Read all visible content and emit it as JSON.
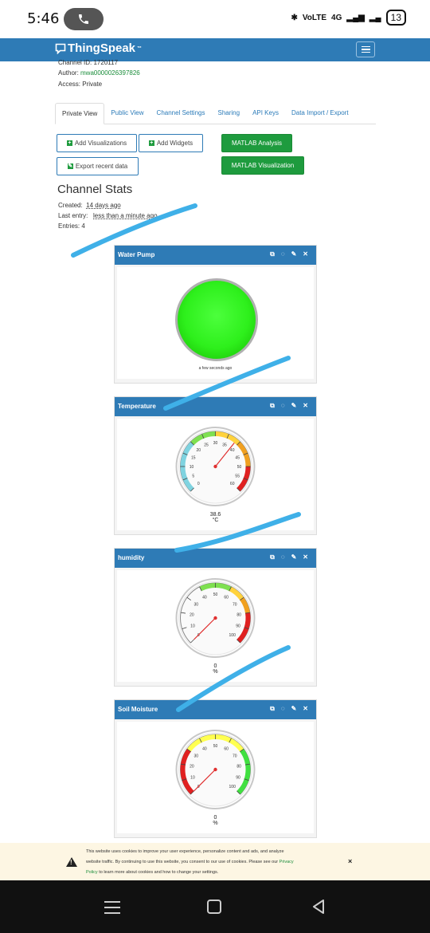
{
  "status_bar": {
    "time": "5:46",
    "network": "4G",
    "battery": "13"
  },
  "navbar": {
    "brand": "ThingSpeak",
    "trademark": "™"
  },
  "channel": {
    "id_text": "Channel ID: 1720117",
    "author_label": "Author: ",
    "author": "mwa0000026397826",
    "access": "Access: Private"
  },
  "tabs": [
    "Private View",
    "Public View",
    "Channel Settings",
    "Sharing",
    "API Keys",
    "Data Import / Export"
  ],
  "buttons": {
    "add_visualizations": "Add Visualizations",
    "add_widgets": "Add Widgets",
    "export_recent": "Export recent data",
    "matlab_analysis": "MATLAB Analysis",
    "matlab_visualization": "MATLAB Visualization"
  },
  "stats": {
    "title": "Channel Stats",
    "created_label": "Created:",
    "created": "14 days ago",
    "last_entry_label": "Last entry:",
    "last_entry": "less than a minute ago",
    "entries": "Entries: 4"
  },
  "panels": [
    {
      "title": "Water Pump",
      "type": "lamp",
      "lamp_color": "#2ef01c",
      "caption": "a few seconds ago"
    },
    {
      "title": "Temperature",
      "type": "gauge",
      "value": 38.6,
      "value_text": "38.6",
      "unit": "°C",
      "min": 0,
      "max": 60,
      "ticks": [
        "0",
        "5",
        "10",
        "15",
        "20",
        "25",
        "30",
        "35",
        "40",
        "45",
        "50",
        "55",
        "60"
      ],
      "bands": [
        {
          "from": 0,
          "to": 20,
          "color": "#7fd3e0"
        },
        {
          "from": 20,
          "to": 30,
          "color": "#7ee050"
        },
        {
          "from": 30,
          "to": 40,
          "color": "#ffd23c"
        },
        {
          "from": 40,
          "to": 50,
          "color": "#f0a020"
        },
        {
          "from": 50,
          "to": 60,
          "color": "#e02020"
        }
      ]
    },
    {
      "title": "humidity",
      "type": "gauge",
      "value": 0,
      "value_text": "0",
      "unit": "%",
      "min": 0,
      "max": 100,
      "ticks": [
        "0",
        "10",
        "20",
        "30",
        "40",
        "50",
        "60",
        "70",
        "80",
        "90",
        "100"
      ],
      "bands": [
        {
          "from": 40,
          "to": 60,
          "color": "#7ee050"
        },
        {
          "from": 60,
          "to": 70,
          "color": "#ffd23c"
        },
        {
          "from": 70,
          "to": 80,
          "color": "#f0a020"
        },
        {
          "from": 80,
          "to": 100,
          "color": "#e02020"
        }
      ]
    },
    {
      "title": "Soil Moisture",
      "type": "gauge",
      "value": 0,
      "value_text": "0",
      "unit": "%",
      "min": 0,
      "max": 100,
      "ticks": [
        "0",
        "10",
        "20",
        "30",
        "40",
        "50",
        "60",
        "70",
        "80",
        "90",
        "100"
      ],
      "bands": [
        {
          "from": 0,
          "to": 30,
          "color": "#e02020"
        },
        {
          "from": 30,
          "to": 70,
          "color": "#ffff50"
        },
        {
          "from": 70,
          "to": 100,
          "color": "#40e040"
        }
      ]
    }
  ],
  "cookie": {
    "line1": "This website uses cookies to improve your user experience, personalize content and ads, and analyze",
    "line2": "website traffic. By continuing to use this website, you consent to our use of cookies. Please see our",
    "link": "Privacy",
    "line3_link": "Policy",
    "line3": " to learn more about cookies and how to change your settings.",
    "close": "×"
  },
  "colors": {
    "brand_blue": "#2e7bb6",
    "action_green": "#1e9b3e",
    "annotation": "#3fb0e8"
  }
}
